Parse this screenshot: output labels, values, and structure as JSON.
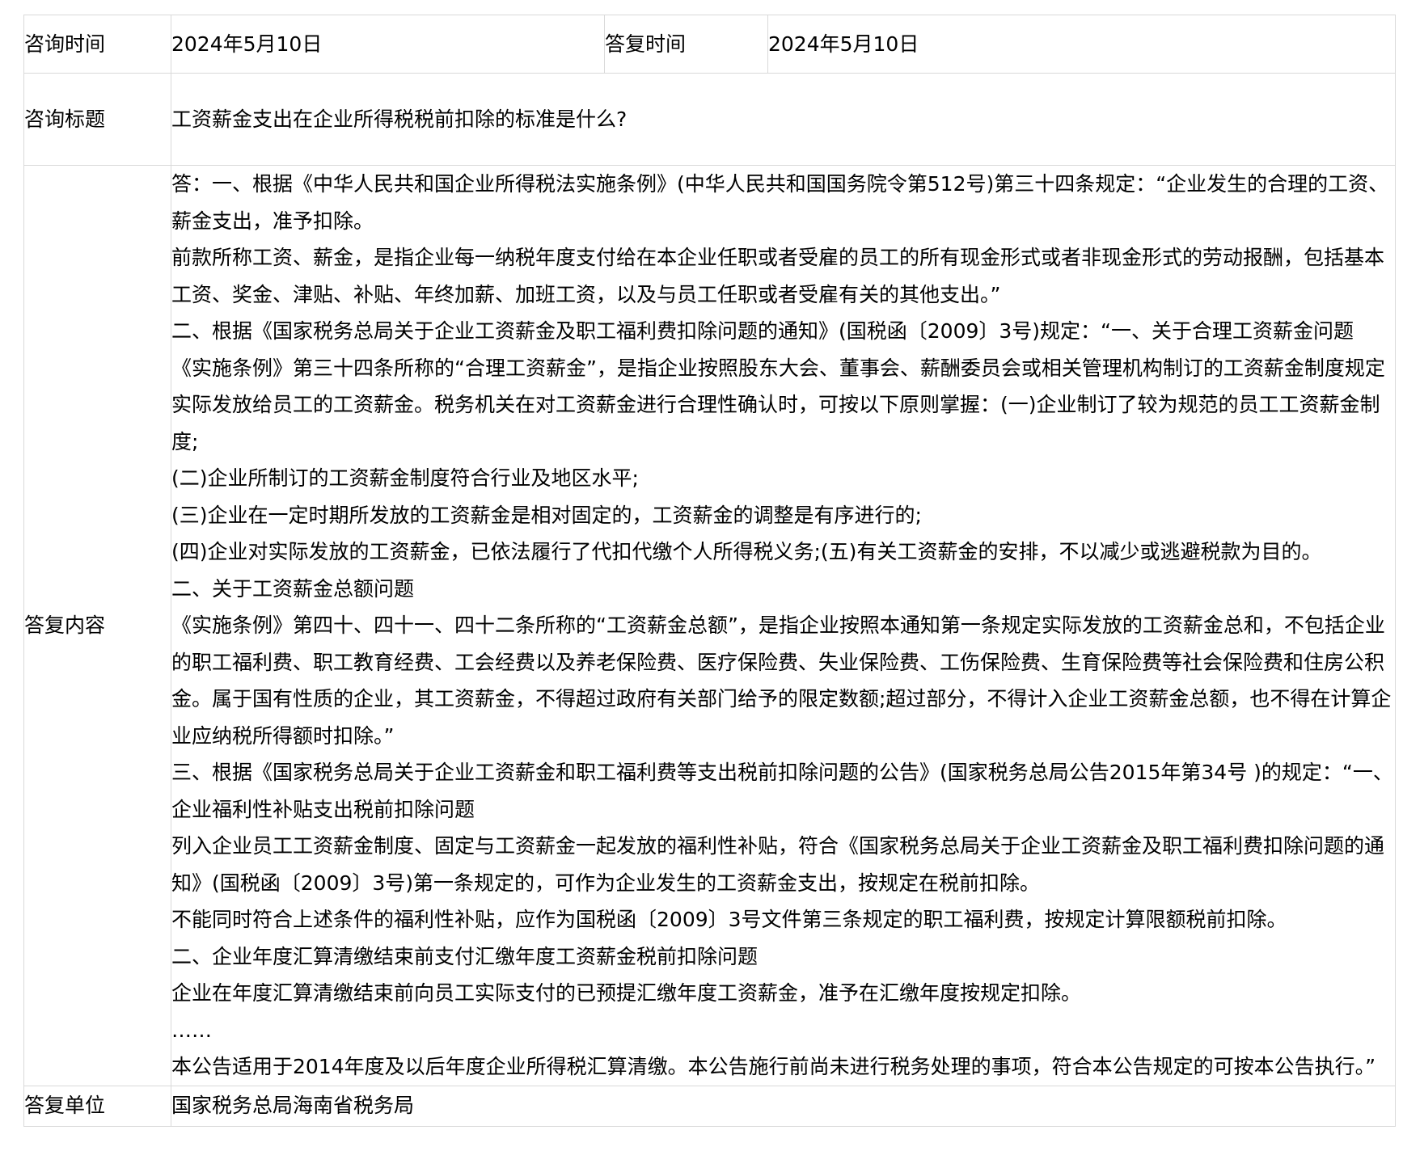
{
  "consult_time": {
    "label": "咨询时间",
    "value": "2024年5月10日"
  },
  "reply_time": {
    "label": "答复时间",
    "value": "2024年5月10日"
  },
  "consult_title": {
    "label": "咨询标题",
    "value": "工资薪金支出在企业所得税税前扣除的标准是什么?"
  },
  "reply_content": {
    "label": "答复内容",
    "paragraphs": [
      "答：一、根据《中华人民共和国企业所得税法实施条例》(中华人民共和国国务院令第512号)第三十四条规定：“企业发生的合理的工资、薪金支出，准予扣除。",
      "前款所称工资、薪金，是指企业每一纳税年度支付给在本企业任职或者受雇的员工的所有现金形式或者非现金形式的劳动报酬，包括基本工资、奖金、津贴、补贴、年终加薪、加班工资，以及与员工任职或者受雇有关的其他支出。”",
      "二、根据《国家税务总局关于企业工资薪金及职工福利费扣除问题的通知》(国税函〔2009〕3号)规定：“一、关于合理工资薪金问题",
      "《实施条例》第三十四条所称的“合理工资薪金”，是指企业按照股东大会、董事会、薪酬委员会或相关管理机构制订的工资薪金制度规定实际发放给员工的工资薪金。税务机关在对工资薪金进行合理性确认时，可按以下原则掌握：(一)企业制订了较为规范的员工工资薪金制度;",
      "(二)企业所制订的工资薪金制度符合行业及地区水平;",
      "(三)企业在一定时期所发放的工资薪金是相对固定的，工资薪金的调整是有序进行的;",
      "(四)企业对实际发放的工资薪金，已依法履行了代扣代缴个人所得税义务;(五)有关工资薪金的安排，不以减少或逃避税款为目的。",
      "二、关于工资薪金总额问题",
      "《实施条例》第四十、四十一、四十二条所称的“工资薪金总额”，是指企业按照本通知第一条规定实际发放的工资薪金总和，不包括企业的职工福利费、职工教育经费、工会经费以及养老保险费、医疗保险费、失业保险费、工伤保险费、生育保险费等社会保险费和住房公积金。属于国有性质的企业，其工资薪金，不得超过政府有关部门给予的限定数额;超过部分，不得计入企业工资薪金总额，也不得在计算企业应纳税所得额时扣除。”",
      "三、根据《国家税务总局关于企业工资薪金和职工福利费等支出税前扣除问题的公告》(国家税务总局公告2015年第34号 )的规定：“一、企业福利性补贴支出税前扣除问题",
      "列入企业员工工资薪金制度、固定与工资薪金一起发放的福利性补贴，符合《国家税务总局关于企业工资薪金及职工福利费扣除问题的通知》(国税函〔2009〕3号)第一条规定的，可作为企业发生的工资薪金支出，按规定在税前扣除。",
      "不能同时符合上述条件的福利性补贴，应作为国税函〔2009〕3号文件第三条规定的职工福利费，按规定计算限额税前扣除。",
      "二、企业年度汇算清缴结束前支付汇缴年度工资薪金税前扣除问题",
      "企业在年度汇算清缴结束前向员工实际支付的已预提汇缴年度工资薪金，准予在汇缴年度按规定扣除。",
      "……",
      "本公告适用于2014年度及以后年度企业所得税汇算清缴。本公告施行前尚未进行税务处理的事项，符合本公告规定的可按本公告执行。”"
    ]
  },
  "reply_unit": {
    "label": "答复单位",
    "value": "国家税务总局海南省税务局"
  }
}
